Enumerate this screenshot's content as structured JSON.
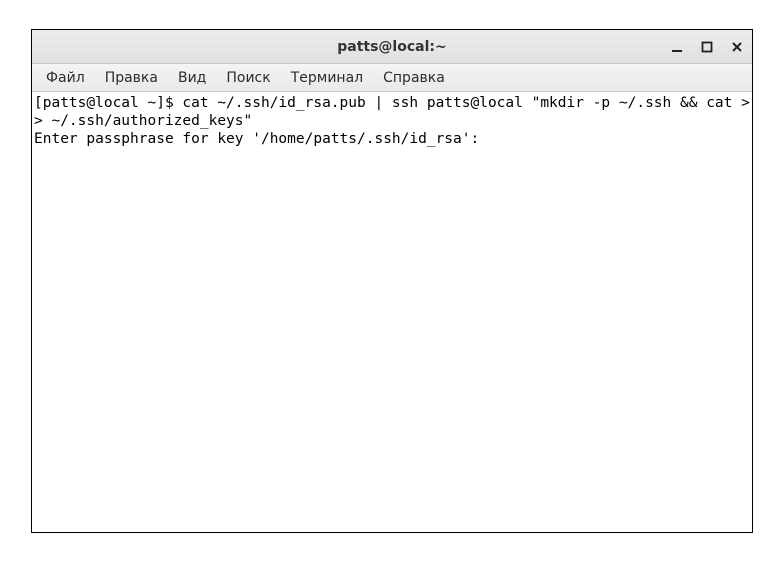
{
  "titlebar": {
    "title": "patts@local:~"
  },
  "menubar": {
    "items": [
      {
        "label": "Файл"
      },
      {
        "label": "Правка"
      },
      {
        "label": "Вид"
      },
      {
        "label": "Поиск"
      },
      {
        "label": "Терминал"
      },
      {
        "label": "Справка"
      }
    ]
  },
  "terminal": {
    "line1": "[patts@local ~]$ cat ~/.ssh/id_rsa.pub | ssh patts@local \"mkdir -p ~/.ssh && cat >> ~/.ssh/authorized_keys\"",
    "line2": "Enter passphrase for key '/home/patts/.ssh/id_rsa':"
  },
  "window_controls": {
    "minimize": "minimize",
    "maximize": "maximize",
    "close": "close"
  }
}
